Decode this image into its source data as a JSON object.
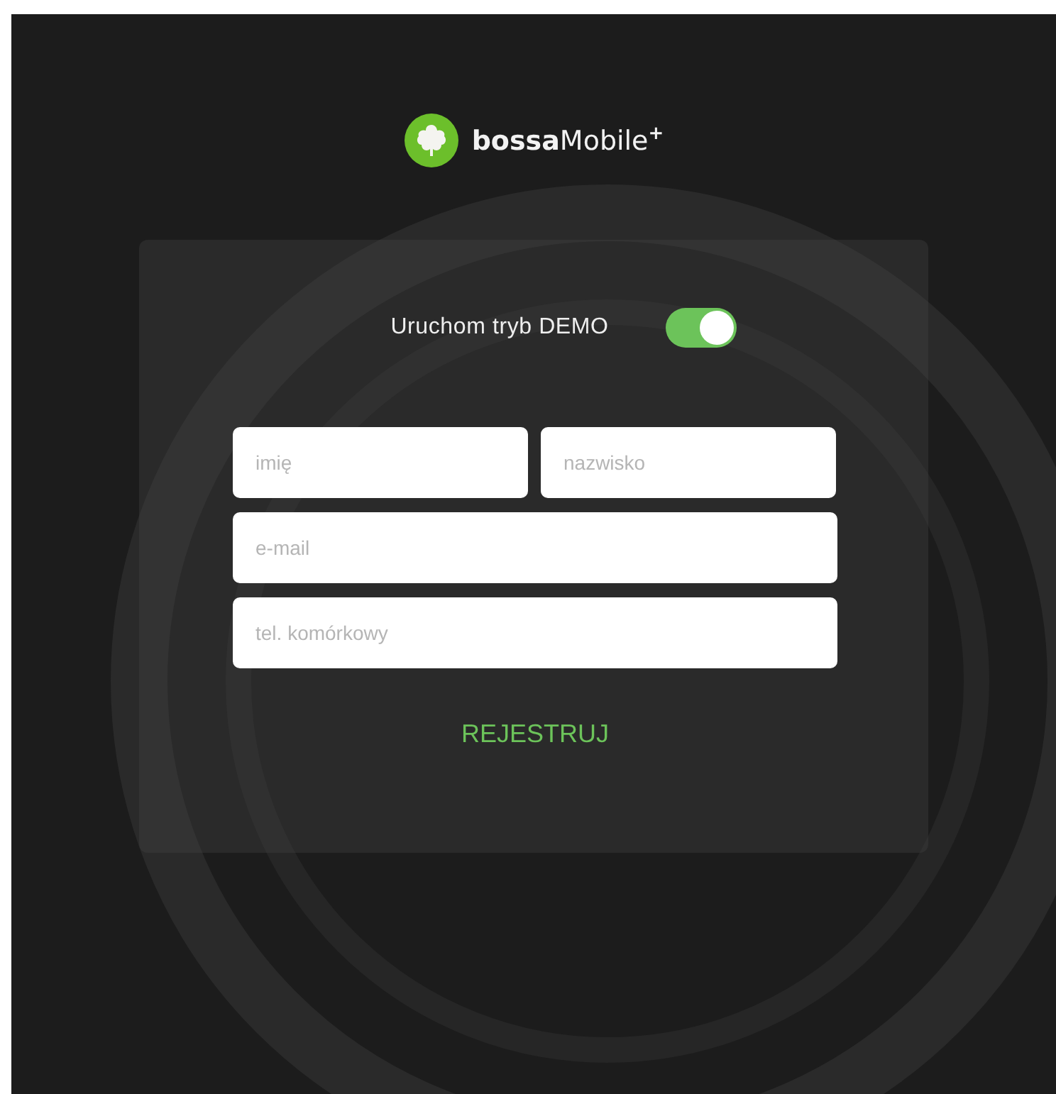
{
  "logo": {
    "text": "**bossa**Mobile$^{+}$"
  },
  "demo": {
    "label": "Uruchom tryb DEMO",
    "on": true
  },
  "fields": [
    {
      "placeholder": "imię"
    },
    {
      "placeholder": "nazwisko"
    },
    {
      "placeholder": "e-mail"
    },
    {
      "placeholder": "tel. komórkowy"
    }
  ],
  "register_button": {
    "label": "REJESTRUJ"
  }
}
